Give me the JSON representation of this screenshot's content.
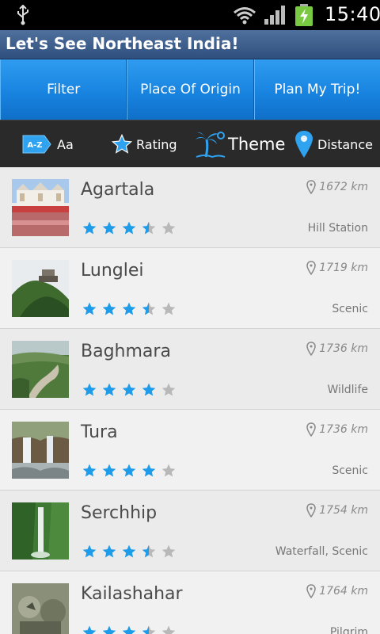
{
  "status_bar": {
    "time": "15:40"
  },
  "app": {
    "title": "Let's See Northeast India!"
  },
  "tabs": [
    {
      "label": "Filter"
    },
    {
      "label": "Place Of Origin"
    },
    {
      "label": "Plan My Trip!"
    }
  ],
  "sort_options": {
    "az": {
      "badge": "A-Z",
      "label": "Aa"
    },
    "rating": {
      "label": "Rating"
    },
    "theme": {
      "label": "Theme"
    },
    "distance": {
      "label": "Distance"
    }
  },
  "places": [
    {
      "name": "Agartala",
      "distance": "1672 km",
      "rating": 3.5,
      "theme": "Hill Station"
    },
    {
      "name": "Lunglei",
      "distance": "1719 km",
      "rating": 3.5,
      "theme": "Scenic"
    },
    {
      "name": "Baghmara",
      "distance": "1736 km",
      "rating": 4,
      "theme": "Wildlife"
    },
    {
      "name": "Tura",
      "distance": "1736 km",
      "rating": 4,
      "theme": "Scenic"
    },
    {
      "name": "Serchhip",
      "distance": "1754 km",
      "rating": 3.5,
      "theme": "Waterfall, Scenic"
    },
    {
      "name": "Kailashahar",
      "distance": "1764 km",
      "rating": 3.5,
      "theme": "Pilgrim"
    }
  ],
  "colors": {
    "star_active": "#1e9be9",
    "star_inactive": "#b8b8b8",
    "tab_blue": "#1884e0",
    "title_bar": "#3f5f8e"
  }
}
